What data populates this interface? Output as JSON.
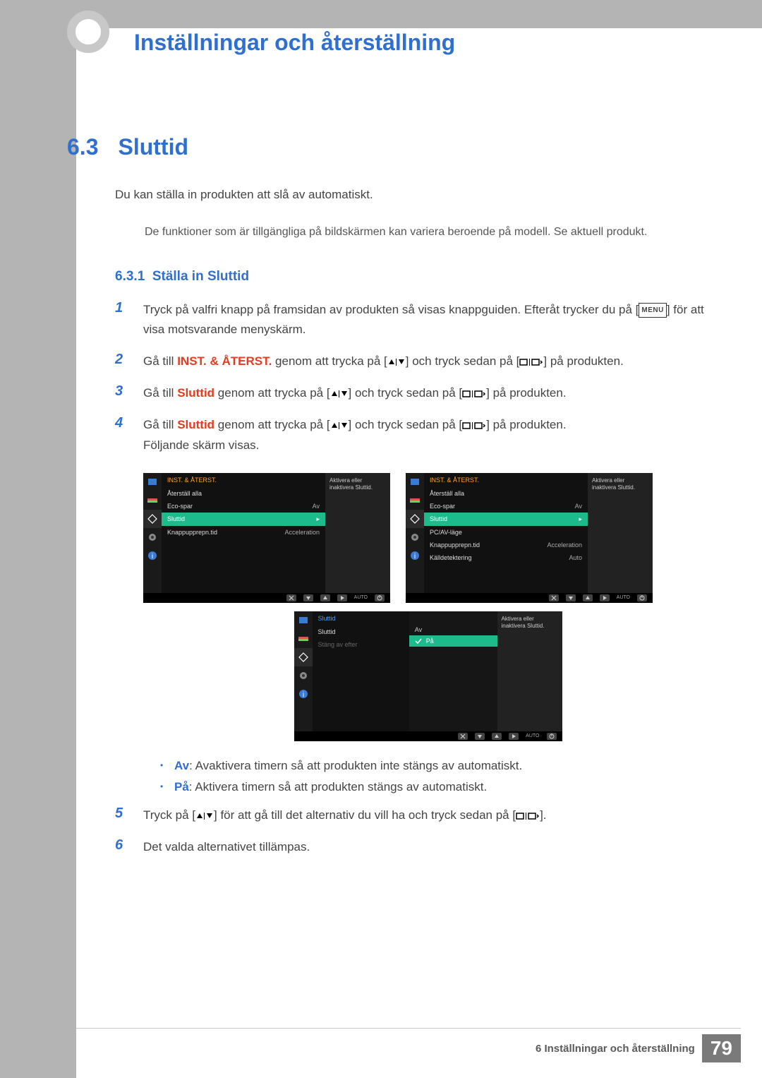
{
  "header": {
    "chapter_title": "Inställningar och återställning"
  },
  "section": {
    "number": "6.3",
    "title": "Sluttid"
  },
  "intro": "Du kan ställa in produkten att slå av automatiskt.",
  "note": "De funktioner som är tillgängliga på bildskärmen kan variera beroende på modell. Se aktuell produkt.",
  "subsection": {
    "number": "6.3.1",
    "title": "Ställa in Sluttid"
  },
  "steps": {
    "s1_a": "Tryck på valfri knapp på framsidan av produkten så visas knappguiden. Efteråt trycker du på [",
    "s1_b": "] för att visa motsvarande menyskärm.",
    "s2_a": "Gå till ",
    "s2_hl": "INST. & ÅTERST.",
    "s2_b": " genom att trycka på [",
    "s2_c": "] och tryck sedan på [",
    "s2_d": "] på produkten.",
    "s3_a": "Gå till ",
    "s3_hl": "Sluttid",
    "s3_b": " genom att trycka på [",
    "s3_c": "] och tryck sedan på [",
    "s3_d": "] på produkten.",
    "s4_a": "Gå till ",
    "s4_hl": "Sluttid",
    "s4_b": " genom att trycka på [",
    "s4_c": "] och tryck sedan på [",
    "s4_d": "] på produkten.",
    "s4_after": "Följande skärm visas.",
    "s5_a": "Tryck på [",
    "s5_b": "] för att gå till det alternativ du vill ha och tryck sedan på [",
    "s5_c": "].",
    "s6": "Det valda alternativet tillämpas."
  },
  "bullets": {
    "off_label": "Av",
    "off_text": ": Avaktivera timern så att produkten inte stängs av automatiskt.",
    "on_label": "På",
    "on_text": ": Aktivera timern så att produkten stängs av automatiskt."
  },
  "menu_label": "MENU",
  "osd": {
    "help": "Aktivera eller inaktivera Sluttid.",
    "title": "INST. & ÅTERST.",
    "left": {
      "items": [
        {
          "label": "Återställ alla",
          "val": ""
        },
        {
          "label": "Eco-spar",
          "val": "Av"
        },
        {
          "label": "Sluttid",
          "val": "▸",
          "sel": true
        },
        {
          "label": "Knappupprepn.tid",
          "val": "Acceleration"
        }
      ]
    },
    "right": {
      "items": [
        {
          "label": "Återställ alla",
          "val": ""
        },
        {
          "label": "Eco-spar",
          "val": "Av"
        },
        {
          "label": "Sluttid",
          "val": "▸",
          "sel": true
        },
        {
          "label": "PC/AV-läge",
          "val": ""
        },
        {
          "label": "Knappupprepn.tid",
          "val": "Acceleration"
        },
        {
          "label": "Källdetektering",
          "val": "Auto"
        }
      ]
    },
    "sluttid_panel": {
      "title": "Sluttid",
      "items": [
        {
          "label": "Sluttid",
          "val": "Av"
        },
        {
          "label": "Stäng av efter",
          "val": "",
          "dim": true
        }
      ],
      "options": {
        "off": "Av",
        "on": "På"
      }
    },
    "auto_label": "AUTO"
  },
  "footer": {
    "chapter_ref": "6 Inställningar och återställning",
    "page": "79"
  }
}
